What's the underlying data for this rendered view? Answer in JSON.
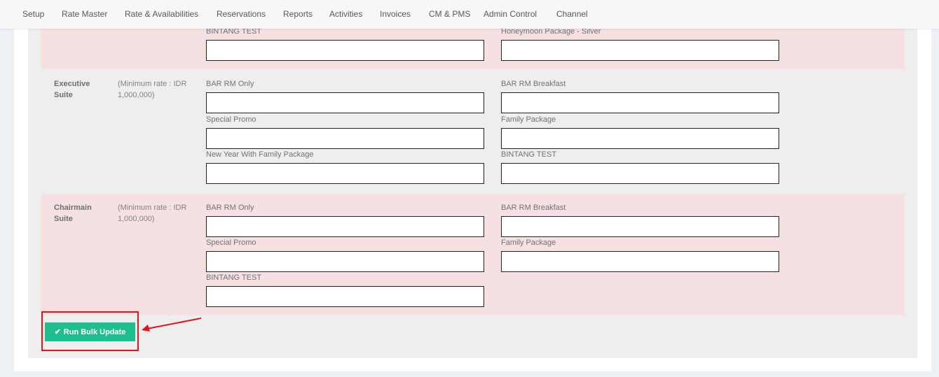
{
  "nav": {
    "items": [
      "Setup",
      "Rate Master",
      "Rate & Availabilities",
      "Reservations",
      "Reports",
      "Activities",
      "Invoices",
      "CM & PMS",
      "Admin Control",
      "Channel"
    ]
  },
  "partial_row": {
    "fields": [
      "BINTANG TEST",
      "Honeymoon Package - Silver"
    ]
  },
  "rooms": [
    {
      "name": "Executive Suite",
      "min_rate": "(Minimum rate : IDR 1,000,000)",
      "fields": [
        "BAR RM Only",
        "BAR RM Breakfast",
        "Special Promo",
        "Family Package",
        "New Year With Family Package",
        "BINTANG TEST"
      ]
    },
    {
      "name": "Chairmain Suite",
      "min_rate": "(Minimum rate : IDR 1,000,000)",
      "fields": [
        "BAR RM Only",
        "BAR RM Breakfast",
        "Special Promo",
        "Family Package",
        "BINTANG TEST"
      ]
    }
  ],
  "actions": {
    "run_bulk_update": "Run Bulk Update",
    "check_icon": "check-icon"
  },
  "colors": {
    "accent_green": "#1fbe8e",
    "highlight_red": "#e0151d",
    "row_pink": "#f6e1e2"
  }
}
